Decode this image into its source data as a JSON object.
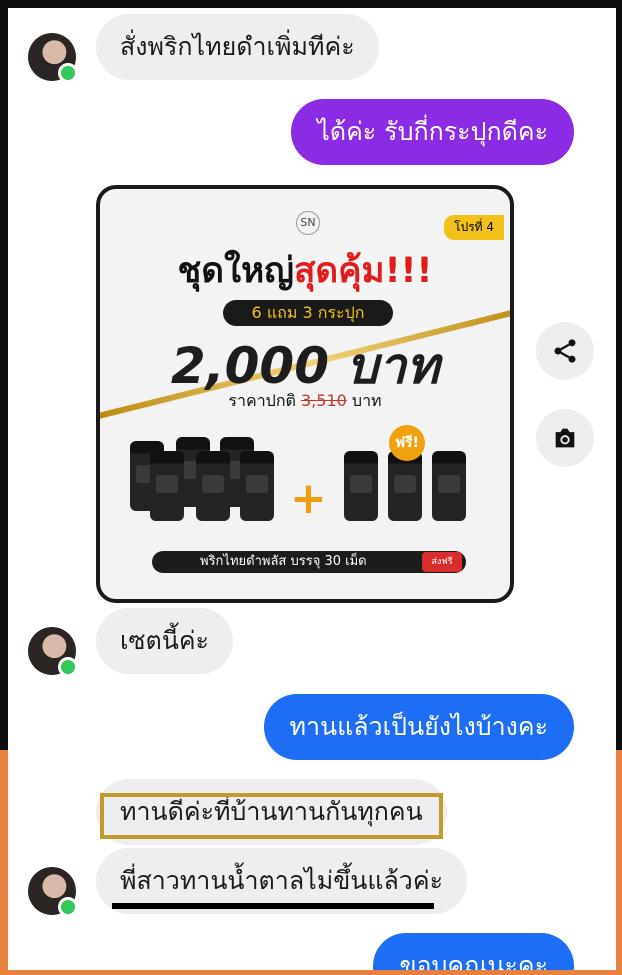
{
  "messages": [
    {
      "side": "received",
      "text": "สั่งพริกไทยดำเพิ่มทีค่ะ"
    },
    {
      "side": "sent",
      "text": "ได้ค่ะ รับกี่กระปุกดีคะ"
    },
    {
      "side": "received",
      "text": "เซตนี้ค่ะ"
    },
    {
      "side": "sent",
      "text": "ทานแล้วเป็นยังไงบ้างคะ"
    },
    {
      "side": "received",
      "text": "ทานดีค่ะที่บ้านทานกันทุกคน"
    },
    {
      "side": "received",
      "text": "พี่สาวทานน้ำตาลไม่ขึ้นแล้วค่ะ"
    },
    {
      "side": "sent",
      "text": "ขอบคุณนะคะ"
    }
  ],
  "promo": {
    "logo": "SN",
    "promo_tag": "โปรที่ 4",
    "title_part1": "ชุดใหญ่",
    "title_part2": "สุดคุ้ม!!!",
    "offer": "6 แถม 3 กระปุก",
    "price": "2,000 บาท",
    "regular_label": "ราคาปกติ",
    "regular_price": "3,510",
    "regular_unit": "บาท",
    "free_badge": "ฟรี!",
    "description": "พริกไทยดำพลัส บรรจุ 30 เม็ด",
    "shipping_badge": "ส่งฟรี"
  },
  "actions": {
    "share_icon": "share-icon",
    "camera_icon": "camera-icon"
  },
  "colors": {
    "purple_bubble": "#8b2be3",
    "blue_bubble": "#1d6ef5",
    "received_bubble": "#eeeef0",
    "highlight_gold": "#c49a2c"
  }
}
